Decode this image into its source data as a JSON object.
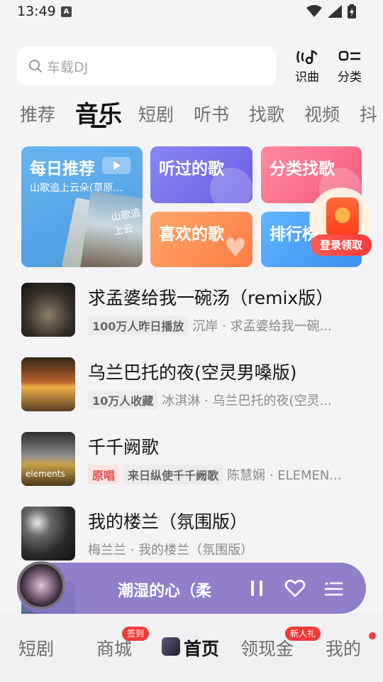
{
  "status_bar": {
    "time": "13:49",
    "a_icon": "A"
  },
  "search": {
    "placeholder": "车载DJ"
  },
  "top_actions": [
    {
      "label": "识曲",
      "icon": "recognize-music-icon"
    },
    {
      "label": "分类",
      "icon": "category-icon"
    }
  ],
  "tabs": [
    "推荐",
    "音乐",
    "短剧",
    "听书",
    "找歌",
    "视频",
    "抖"
  ],
  "active_tab": "音乐",
  "cards": {
    "daily": {
      "title": "每日推荐",
      "subtitle": "山歌追上云朵(草原...",
      "album_text": "山歌追上云"
    },
    "heard": {
      "title": "听过的歌"
    },
    "category": {
      "title": "分类找歌"
    },
    "liked": {
      "title": "喜欢的歌"
    },
    "rank": {
      "title": "排行榜"
    }
  },
  "promo": {
    "label": "登录领取"
  },
  "songs": [
    {
      "title": "求孟婆给我一碗汤（remix版）",
      "tags": [
        "100万人昨日播放"
      ],
      "artist": "沉岸 · 求孟婆给我一碗..."
    },
    {
      "title": "乌兰巴托的夜(空灵男嗓版)",
      "tags": [
        "10万人收藏"
      ],
      "artist": "冰淇淋 · 乌兰巴托的夜(空灵..."
    },
    {
      "title": "千千阙歌",
      "tags": [
        "原唱",
        "来日纵使千千阙歌"
      ],
      "artist": "陈慧娴 · ELEMEN...",
      "cover_text": "elements"
    },
    {
      "title": "我的楼兰（氛围版）",
      "tags": [],
      "artist": "梅兰兰 · 我的楼兰（氛围版）"
    }
  ],
  "player": {
    "title": "潮湿的心（柔"
  },
  "bottom_nav": [
    {
      "label": "短剧"
    },
    {
      "label": "商城",
      "badge": "签到"
    },
    {
      "label": "首页"
    },
    {
      "label": "领现金",
      "badge": "新人礼"
    },
    {
      "label": "我的"
    }
  ],
  "colors": {
    "accent_red": "#f23a3a",
    "player_bg": "#8575c4"
  }
}
